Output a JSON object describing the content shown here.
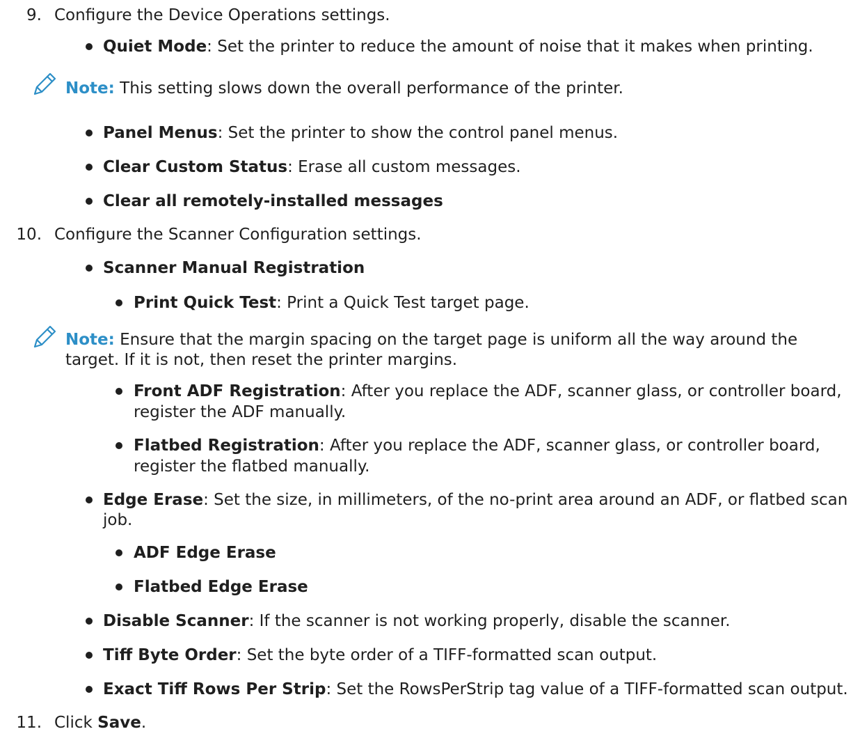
{
  "steps": [
    {
      "number": "9.",
      "text": "Configure the Device Operations settings."
    },
    {
      "number": "10.",
      "text": "Configure the Scanner Configuration settings."
    },
    {
      "number": "11.",
      "text_before": "Click ",
      "bold": "Save",
      "text_after": "."
    }
  ],
  "device_ops": [
    {
      "label": "Quiet Mode",
      "text": ": Set the printer to reduce the amount of noise that it makes when printing."
    },
    {
      "label": "Panel Menus",
      "text": ": Set the printer to show the control panel menus."
    },
    {
      "label": "Clear Custom Status",
      "text": ": Erase all custom messages."
    },
    {
      "label": "Clear all remotely-installed messages",
      "text": ""
    }
  ],
  "note1": {
    "label": "Note:",
    "text": " This setting slows down the overall performance of the printer."
  },
  "scanner": {
    "manual_reg": "Scanner Manual Registration",
    "quick_test": {
      "label": "Print Quick Test",
      "text": ": Print a Quick Test target page."
    },
    "note2": {
      "label": "Note:",
      "line1": " Ensure that the margin spacing on the target page is uniform all the way around the",
      "line2": "target. If it is not, then reset the printer margins."
    },
    "front_adf": {
      "label": "Front ADF Registration",
      "line1": ": After you replace the ADF, scanner glass, or controller board,",
      "line2": "register the ADF manually."
    },
    "flatbed_reg": {
      "label": "Flatbed Registration",
      "line1": ": After you replace the ADF, scanner glass, or controller board,",
      "line2": "register the flatbed manually."
    },
    "edge_erase": {
      "label": "Edge Erase",
      "line1": ": Set the size, in millimeters, of the no-print area around an ADF, or flatbed scan",
      "line2": "job."
    },
    "adf_edge": "ADF Edge Erase",
    "flatbed_edge": "Flatbed Edge Erase",
    "disable": {
      "label": "Disable Scanner",
      "text": ": If the scanner is not working properly, disable the scanner."
    },
    "tiff_order": {
      "label": "Tiff Byte Order",
      "text": ": Set the byte order of a TIFF-formatted scan output."
    },
    "tiff_rows": {
      "label": "Exact Tiff Rows Per Strip",
      "text": ": Set the RowsPerStrip tag value of a TIFF-formatted scan output."
    }
  },
  "icons": {
    "note": "pencil-icon"
  },
  "colors": {
    "note_label": "#2d8fc7",
    "text": "#1f1f1f"
  }
}
